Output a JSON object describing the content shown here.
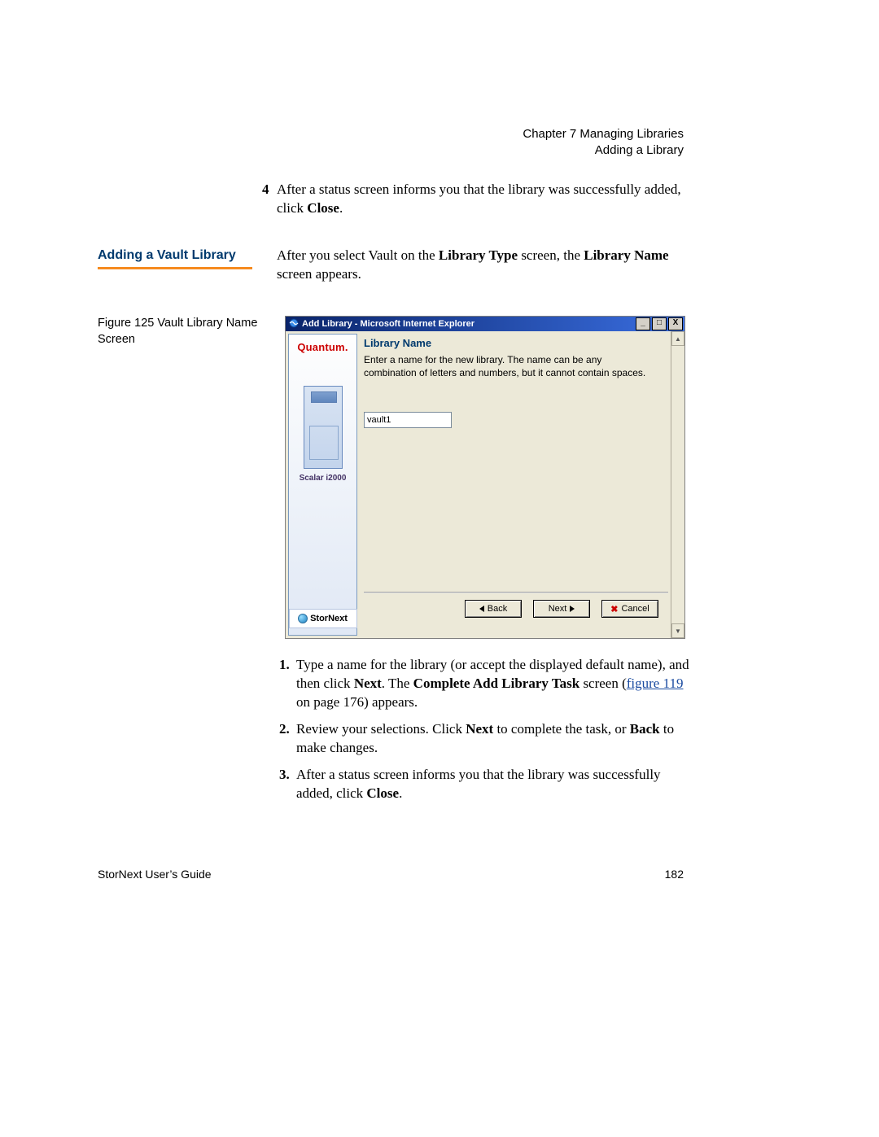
{
  "header": {
    "chapter_line": "Chapter 7  Managing Libraries",
    "section_line": "Adding a Library"
  },
  "step4": {
    "number": "4",
    "text_a": "After a status screen informs you that the library was successfully added, click ",
    "text_bold": "Close",
    "text_end": "."
  },
  "section_heading": "Adding a Vault Library",
  "section_intro": {
    "a": "After you select Vault on the ",
    "b1": "Library Type",
    "c": " screen, the ",
    "b2": "Library Name",
    "d": " screen appears."
  },
  "figure_caption": "Figure 125  Vault Library Name Screen",
  "screenshot": {
    "title": "Add Library - Microsoft Internet Explorer",
    "content_heading": "Library Name",
    "content_text": "Enter a name for the new library. The name can be any combination of letters and numbers, but it cannot contain spaces.",
    "input_value": "vault1",
    "side": {
      "brand": "Quantum",
      "model": "Scalar i2000",
      "product": "StorNext"
    },
    "buttons": {
      "back": "Back",
      "next": "Next",
      "cancel": "Cancel"
    },
    "win_icons": {
      "min": "_",
      "max": "□",
      "close": "X"
    }
  },
  "steps": {
    "s1": {
      "a": "Type a name for the library (or accept the displayed default name), and then click ",
      "b1": "Next",
      "c": ". The ",
      "b2": "Complete Add Library Task",
      "d": " screen (",
      "link": "figure 119",
      "e": " on page 176) appears."
    },
    "s2": {
      "a": "Review your selections. Click ",
      "b1": "Next",
      "c": " to complete the task, or ",
      "b2": "Back",
      "d": " to make changes."
    },
    "s3": {
      "a": "After a status screen informs you that the library was successfully added, click ",
      "b1": "Close",
      "c": "."
    }
  },
  "footer": {
    "left": "StorNext User’s Guide",
    "right": "182"
  }
}
